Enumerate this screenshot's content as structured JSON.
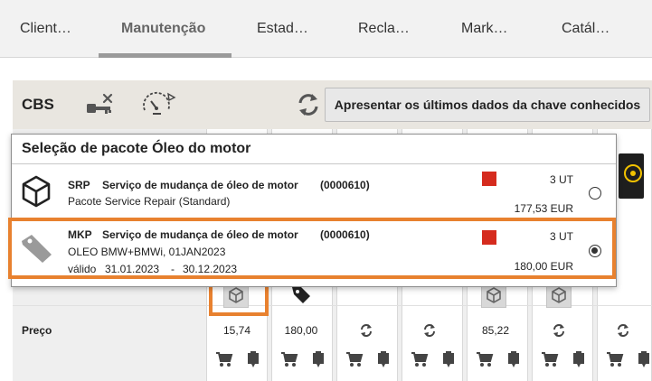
{
  "nav": {
    "tabs": [
      {
        "label": "Client…"
      },
      {
        "label": "Manutenção"
      },
      {
        "label": "Estad…"
      },
      {
        "label": "Recla…"
      },
      {
        "label": "Mark…"
      },
      {
        "label": "Catál…"
      }
    ],
    "active_index": 1
  },
  "cbs": {
    "label": "CBS",
    "key_button_label": "Apresentar os últimos dados da chave conhecidos",
    "icons": [
      "key-delete-icon",
      "gauge-icon",
      "refresh-icon"
    ]
  },
  "table": {
    "price_row_label": "Preço",
    "prices": [
      "15,74",
      "180,00",
      "",
      "",
      "85,22",
      "",
      ""
    ],
    "icons": [
      "package-icon",
      "tag-icon",
      "refresh-icon",
      "refresh-icon",
      "package-icon",
      "package-icon",
      "refresh-icon"
    ],
    "footer_icons": [
      "cart-icon",
      "clipboard-icon"
    ]
  },
  "popup": {
    "title": "Seleção de pacote Óleo do motor",
    "options": [
      {
        "code": "SRP",
        "description": "Serviço de mudança de óleo de motor",
        "number": "(0000610)",
        "subtitle": "Pacote Service Repair (Standard)",
        "validity_label": "",
        "valid_from": "",
        "valid_sep": "",
        "valid_to": "",
        "quantity": "3 UT",
        "price": "177,53 EUR",
        "selected": false,
        "icon": "package-icon"
      },
      {
        "code": "MKP",
        "description": "Serviço de mudança de óleo de motor",
        "number": "(0000610)",
        "subtitle": "OLEO BMW+BMWi, 01JAN2023",
        "validity_label": "válido",
        "valid_from": "31.01.2023",
        "valid_sep": "-",
        "valid_to": "30.12.2023",
        "quantity": "3 UT",
        "price": "180,00 EUR",
        "selected": true,
        "icon": "price-tag-icon"
      }
    ]
  },
  "colors": {
    "highlight": "#e8812f",
    "status_red": "#d52b1e"
  }
}
